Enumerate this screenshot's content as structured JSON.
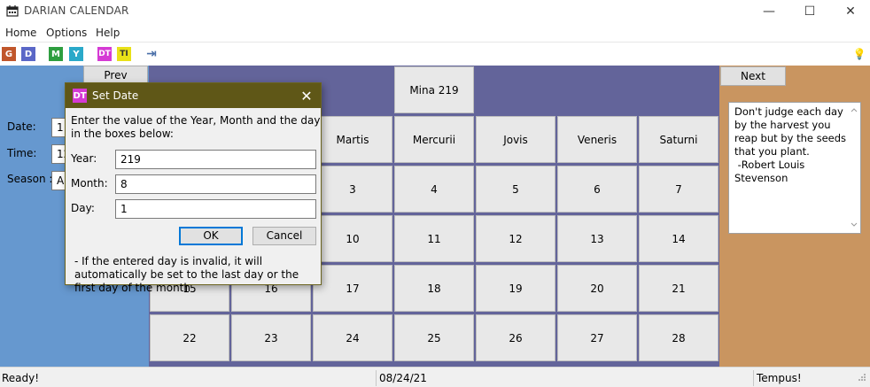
{
  "window": {
    "title": "DARIAN CALENDAR",
    "minimize": "—",
    "maximize": "☐",
    "close": "✕"
  },
  "menu": [
    "Home",
    "Options",
    "Help"
  ],
  "toolbar": {
    "icons": [
      {
        "name": "g-icon",
        "glyph": "G",
        "color": "#c0562b"
      },
      {
        "name": "d-icon",
        "glyph": "D",
        "color": "#5a67c7"
      },
      {
        "name": "m-icon",
        "glyph": "M",
        "color": "#2e9e3f"
      },
      {
        "name": "y-icon",
        "glyph": "Y",
        "color": "#2aa9c9"
      },
      {
        "name": "dt-icon",
        "glyph": "DT",
        "color": "#d53ad4"
      },
      {
        "name": "ti-icon",
        "glyph": "TI",
        "color": "#e9e118"
      },
      {
        "name": "exit-icon",
        "glyph": "⇥",
        "color": "#4a6fa8"
      }
    ],
    "hint_icon": "💡"
  },
  "left": {
    "date_label": "Date:",
    "time_label": "Time:",
    "season_label": "Season :",
    "date_value": "1",
    "time_value": "12",
    "season_value": "A"
  },
  "calendar": {
    "prev_label": "Prev",
    "next_label": "Next",
    "month_title": "Mina 219",
    "weekdays": [
      "",
      "",
      "Martis",
      "Mercurii",
      "Jovis",
      "Veneris",
      "Saturni"
    ],
    "rows": [
      [
        "",
        "",
        "3",
        "4",
        "5",
        "6",
        "7"
      ],
      [
        "",
        "",
        "10",
        "11",
        "12",
        "13",
        "14"
      ],
      [
        "15",
        "16",
        "17",
        "18",
        "19",
        "20",
        "21"
      ],
      [
        "22",
        "23",
        "24",
        "25",
        "26",
        "27",
        "28"
      ]
    ]
  },
  "quote": "Don't judge each day by the harvest you reap but by the seeds that you plant.\n -Robert Louis Stevenson",
  "status": {
    "left": "Ready!",
    "middle": "08/24/21",
    "right": "Tempus!"
  },
  "dialog": {
    "title": "Set Date",
    "icon_glyph": "DT",
    "instruction": "Enter the value of the Year, Month and the day in the boxes below:",
    "year_label": "Year:",
    "month_label": "Month:",
    "day_label": "Day:",
    "year_value": "219",
    "month_value": "8",
    "day_value": "1",
    "ok_label": "OK",
    "cancel_label": "Cancel",
    "note": "- If the entered day is invalid, it will automatically be set to the last day or the first day of the month"
  },
  "colors": {
    "left_pane": "#6698cf",
    "calendar_bg": "#63649a",
    "right_pane": "#c99560",
    "dialog_title": "#5f5717"
  }
}
